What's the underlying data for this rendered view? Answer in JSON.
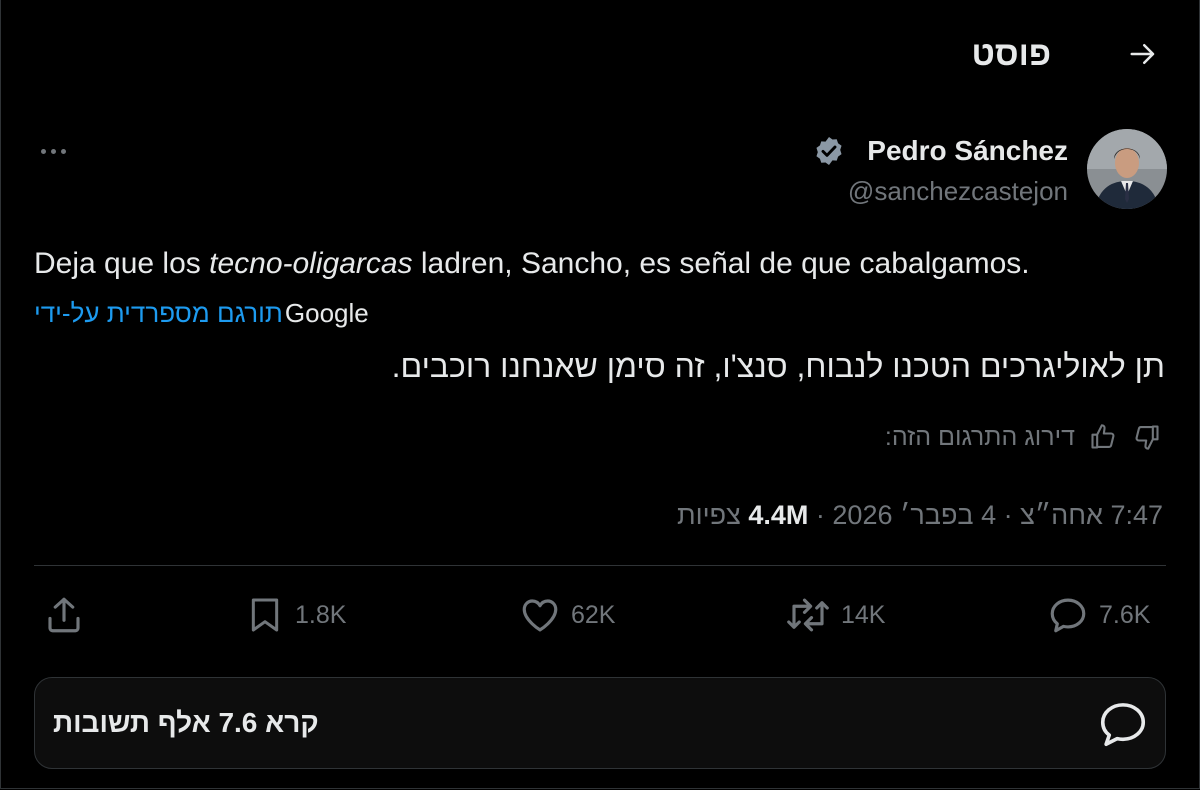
{
  "header": {
    "title": "פוסט",
    "back_icon": "arrow-right-icon"
  },
  "author": {
    "name": "Pedro Sánchez",
    "handle": "@sanchezcastejon",
    "verified_icon": "verified-badge-icon",
    "verified_color": "#8b98a5"
  },
  "tweet": {
    "text_before": "Deja que los ",
    "text_italic": "tecno-oligarcas",
    "text_after": " ladren, Sancho, es señal de que cabalgamos.",
    "translated_by_label": "תורגם מספרדית על-ידי",
    "translator_name": "Google",
    "translated_text": "תן לאוליגרכים הטכנו לנבוח, סנצ'ו, זה סימן שאנחנו רוכבים.",
    "rate_label": "דירוג התרגום הזה:",
    "timestamp": "7:47 אחה״צ · 4 בפבר׳ 2026",
    "views_count": "4.4M",
    "views_label": "צפיות"
  },
  "actions": {
    "replies": "7.6K",
    "reposts": "14K",
    "likes": "62K",
    "bookmarks": "1.8K"
  },
  "reply_bar": {
    "label": "קרא 7.6 אלף תשובות"
  },
  "colors": {
    "background": "#000000",
    "text": "#e7e9ea",
    "muted": "#71767b",
    "link": "#1d9bf0",
    "border": "#2f3336"
  }
}
